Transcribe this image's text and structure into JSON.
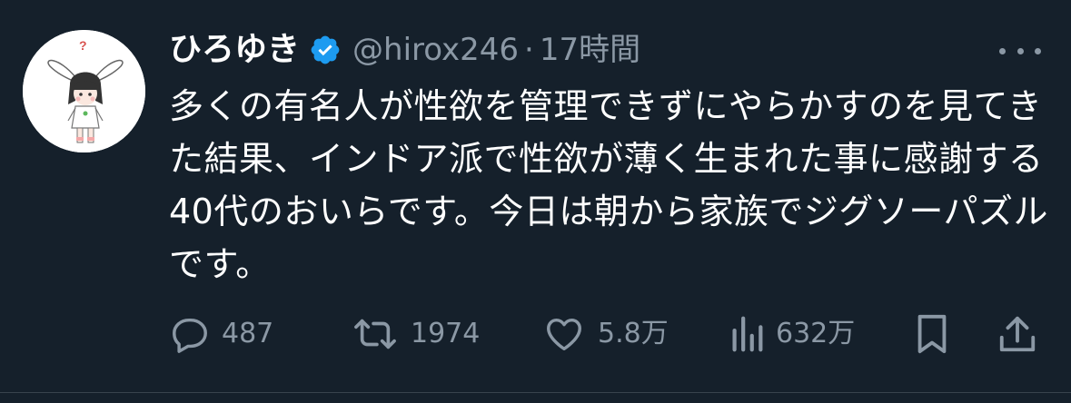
{
  "author": {
    "display_name": "ひろゆき",
    "handle": "@hirox246",
    "separator": "·",
    "time": "17時間",
    "verified": true
  },
  "tweet": {
    "text": "多くの有名人が性欲を管理できずにやらかすのを見てきた結果、インドア派で性欲が薄く生まれた事に感謝する40代のおいらです。今日は朝から家族でジグソーパズルです。"
  },
  "actions": {
    "replies": "487",
    "retweets": "1974",
    "likes": "5.8万",
    "views": "632万"
  },
  "colors": {
    "background": "#15202b",
    "text": "#ffffff",
    "muted": "#8b98a5",
    "verified": "#1d9bf0"
  },
  "icons": {
    "reply": "speech-bubble-icon",
    "retweet": "retweet-arrows-icon",
    "like": "heart-icon",
    "views": "bar-chart-icon",
    "bookmark": "bookmark-icon",
    "share": "share-upload-icon",
    "more": "more-dots-icon",
    "verified": "verified-badge-icon"
  }
}
